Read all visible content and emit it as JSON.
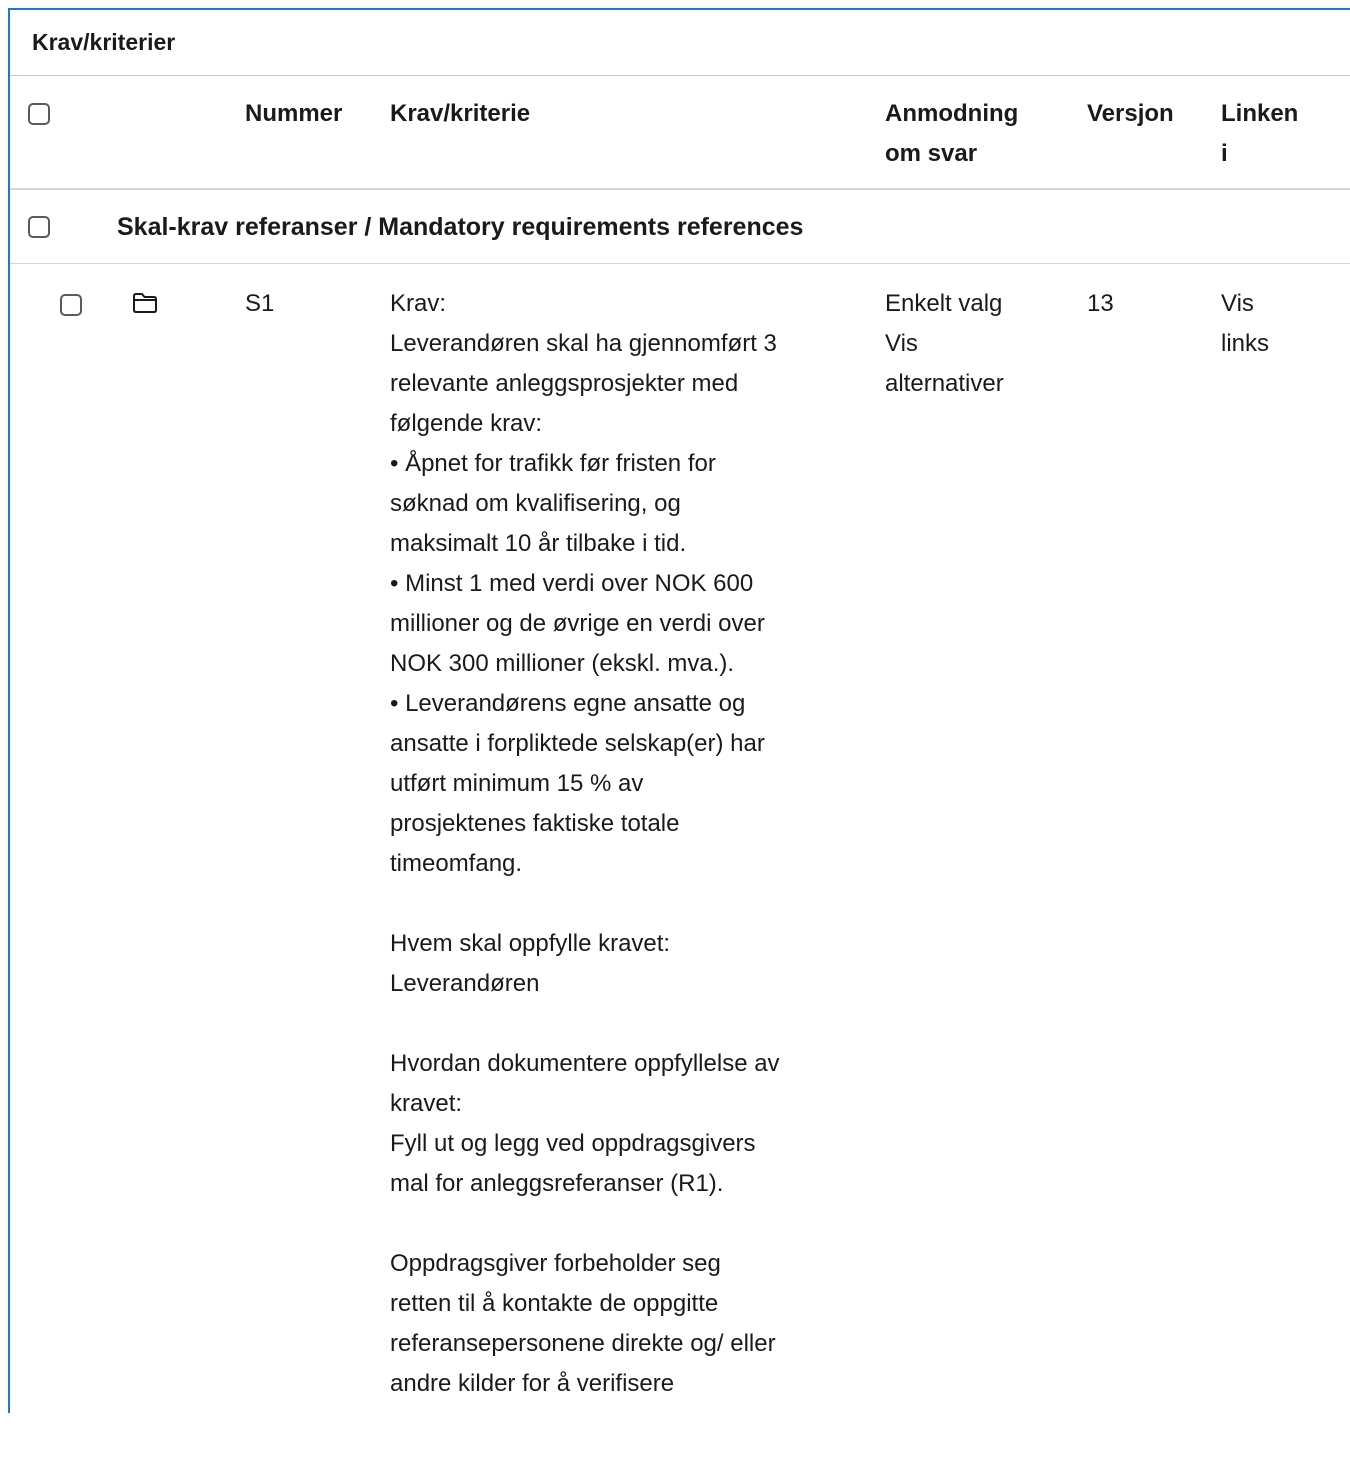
{
  "panel": {
    "title": "Krav/kriterier"
  },
  "table": {
    "columns": {
      "nummer": "Nummer",
      "krav": "Krav/kriterie",
      "anmodning_line1": "Anmodning",
      "anmodning_line2": "om svar",
      "versjon": "Versjon",
      "linken_line1": "Linken",
      "linken_line2": "i"
    },
    "group": {
      "title": "Skal-krav referanser / Mandatory requirements references"
    },
    "rows": [
      {
        "icon": "folder-icon",
        "nummer": "S1",
        "krav_text": "Krav:\nLeverandøren skal ha gjennomført 3\nrelevante anleggsprosjekter med\nfølgende krav:\n• Åpnet for trafikk før fristen for\nsøknad om kvalifisering, og\nmaksimalt 10 år tilbake i tid.\n• Minst 1 med verdi over NOK 600\nmillioner og de øvrige en verdi over\nNOK 300 millioner (ekskl. mva.).\n• Leverandørens egne ansatte og\nansatte i forpliktede selskap(er) har\nutført minimum 15 % av\nprosjektenes faktiske totale\ntimeomfang.\n\nHvem skal oppfylle kravet:\nLeverandøren\n\nHvordan dokumentere oppfyllelse av\nkravet:\nFyll ut og legg ved oppdragsgivers\nmal for anleggsreferanser (R1).\n\nOppdragsgiver forbeholder seg\nretten til å kontakte de oppgitte\nreferansepersonene direkte og/ eller\nandre kilder for å verifisere",
        "anmodning": "Enkelt valg",
        "vis_alternativer_1": "Vis",
        "vis_alternativer_2": "alternativer",
        "versjon": "13",
        "vis_links_1": "Vis",
        "vis_links_2": "links"
      }
    ]
  }
}
